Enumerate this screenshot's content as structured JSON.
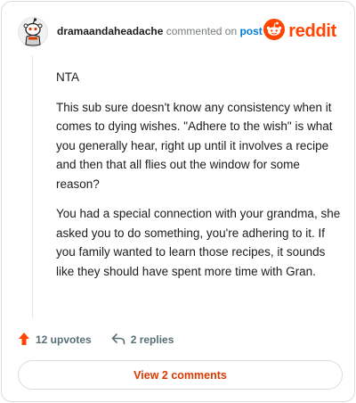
{
  "header": {
    "username": "dramaandaheadache",
    "commented_text": "commented on",
    "post_link": "post",
    "brand": "reddit"
  },
  "comment": {
    "paragraphs": [
      "NTA",
      "This sub sure doesn't know any consistency when it comes to dying wishes. \"Adhere to the wish\" is what you generally hear, right up until it involves a recipe and then that all flies out the window for some reason?",
      "You had a special connection with your grandma, she asked you to do something, you're adhering to it. If you family wanted to learn those recipes, it sounds like they should have spent more time with Gran."
    ]
  },
  "actions": {
    "upvotes": "12 upvotes",
    "replies": "2 replies"
  },
  "footer": {
    "view_comments": "View 2 comments"
  },
  "colors": {
    "brand": "#ff4500",
    "link": "#0079d3",
    "upvote": "#ff4500",
    "button_text": "#d93900"
  },
  "icons": {
    "avatar": "snoo-avatar-icon",
    "brand_logo": "reddit-logo-icon",
    "upvote": "upvote-arrow-icon",
    "reply": "reply-arrow-icon"
  }
}
